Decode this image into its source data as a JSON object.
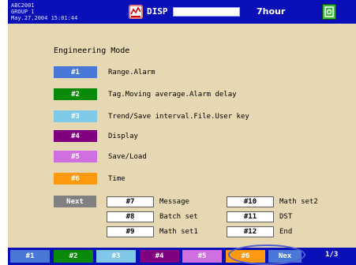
{
  "header": {
    "info_lines": [
      "ABC2001",
      "GROUP 1",
      "May.27.2004 15:01:44"
    ],
    "mode_label": "DISP",
    "period_label": "7hour",
    "disp_icon": "recorder-chart-icon",
    "media_icon": "storage-media-icon"
  },
  "main": {
    "title": "Engineering Mode",
    "menu": [
      {
        "key": "#1",
        "label": "Range.Alarm",
        "color": "#4a78d8"
      },
      {
        "key": "#2",
        "label": "Tag.Moving average.Alarm delay",
        "color": "#0a8a0a"
      },
      {
        "key": "#3",
        "label": "Trend/Save interval.File.User key",
        "color": "#7fc8e8"
      },
      {
        "key": "#4",
        "label": "Display",
        "color": "#800080"
      },
      {
        "key": "#5",
        "label": "Save/Load",
        "color": "#d070e0"
      },
      {
        "key": "#6",
        "label": "Time",
        "color": "#ff9a10"
      }
    ],
    "next_label": "Next",
    "sub_keys": [
      {
        "key": "#7",
        "label": "Message"
      },
      {
        "key": "#8",
        "label": "Batch set"
      },
      {
        "key": "#9",
        "label": "Math set1"
      },
      {
        "key": "#10",
        "label": "Math set2"
      },
      {
        "key": "#11",
        "label": "DST"
      },
      {
        "key": "#12",
        "label": "End"
      }
    ]
  },
  "footer": {
    "soft_keys": [
      {
        "label": "#1",
        "color": "#4a78d8"
      },
      {
        "label": "#2",
        "color": "#0a8a0a"
      },
      {
        "label": "#3",
        "color": "#7fc8e8"
      },
      {
        "label": "#4",
        "color": "#800080"
      },
      {
        "label": "#5",
        "color": "#d070e0"
      },
      {
        "label": "#6",
        "color": "#ff9a10"
      }
    ],
    "next_label": "Nex",
    "page_indicator": "1/3"
  }
}
